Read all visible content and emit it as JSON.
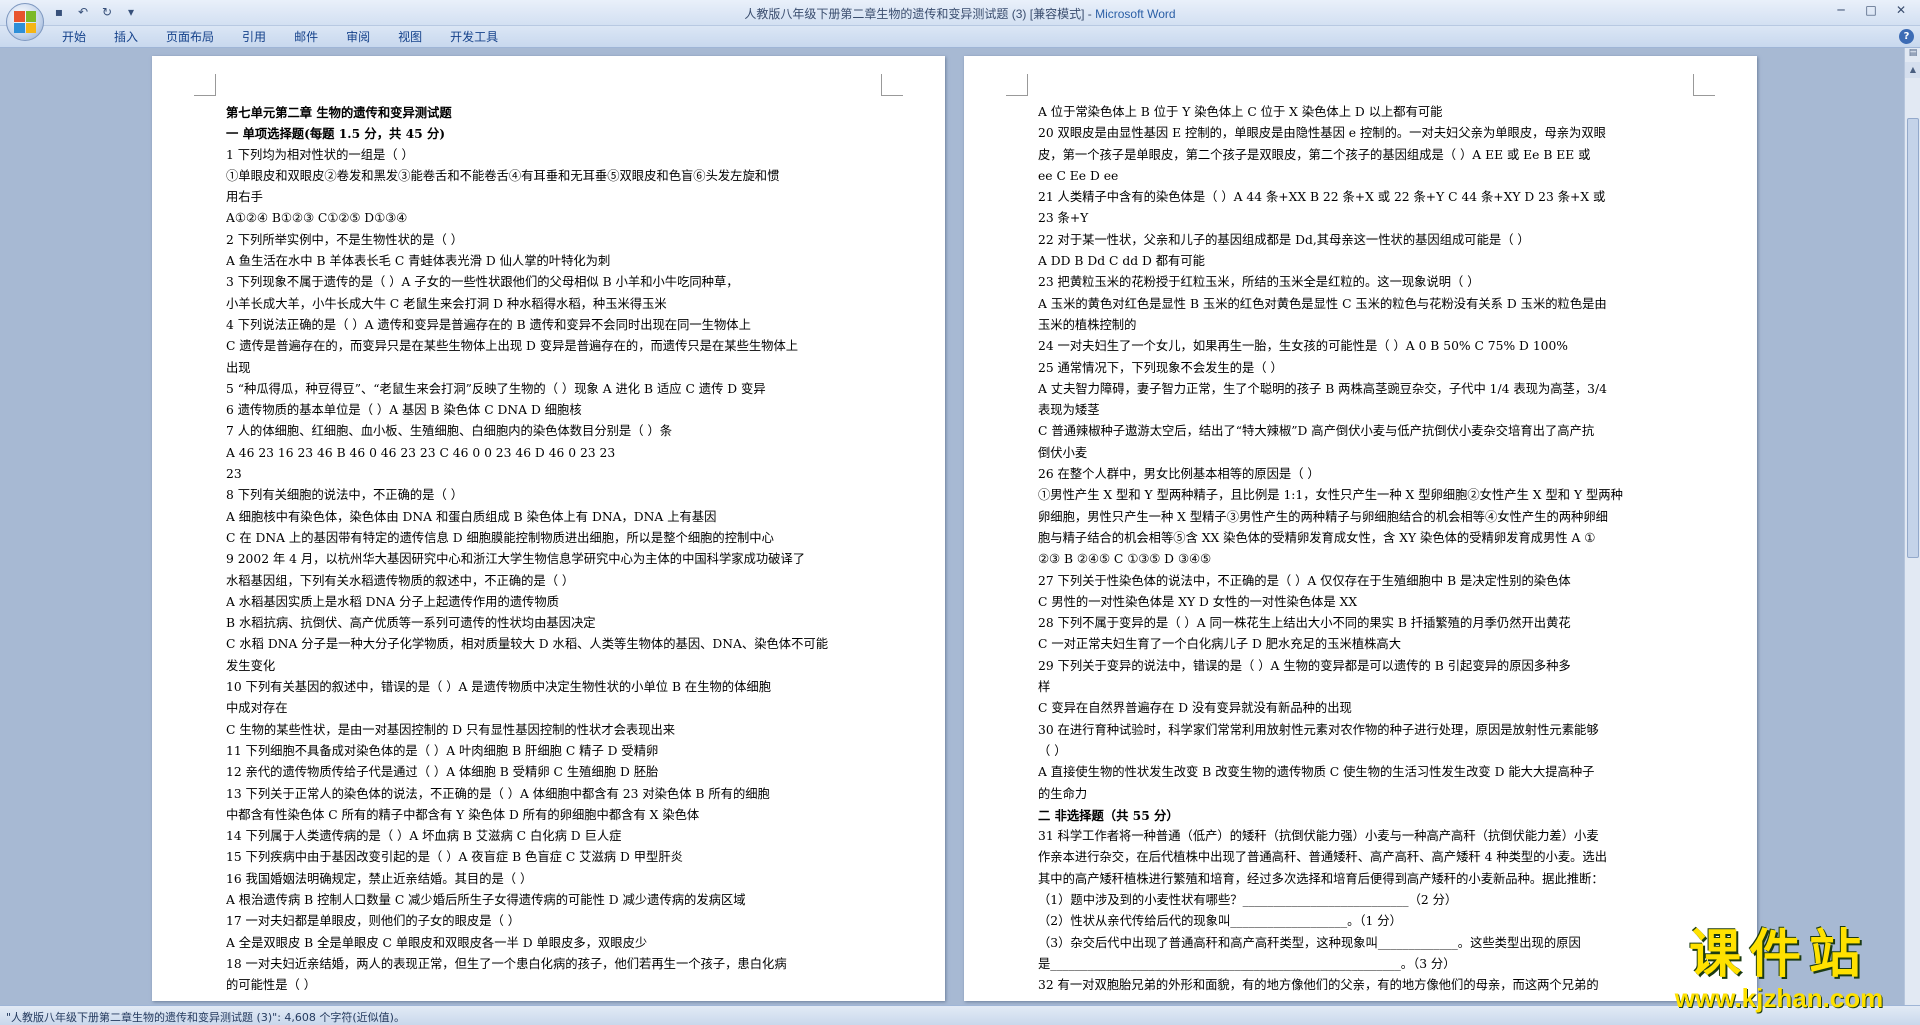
{
  "window": {
    "title": "人教版八年级下册第二章生物的遗传和变异测试题 (3) [兼容模式] - ",
    "app_name": "Microsoft Word"
  },
  "ribbon": {
    "tabs": [
      "开始",
      "插入",
      "页面布局",
      "引用",
      "邮件",
      "审阅",
      "视图",
      "开发工具"
    ]
  },
  "status": {
    "text": "\"人教版八年级下册第二章生物的遗传和变异测试题 (3)\": 4,608 个字符(近似值)。"
  },
  "watermark": {
    "title": "课件站",
    "url": "www.kjzhan.com"
  },
  "page1": {
    "lines": [
      "第七单元第二章 生物的遗传和变异测试题",
      "一 单项选择题(每题 1.5 分，共 45 分)",
      "1 下列均为相对性状的一组是（    ）",
      "①单眼皮和双眼皮②卷发和黑发③能卷舌和不能卷舌④有耳垂和无耳垂⑤双眼皮和色盲⑥头发左旋和惯",
      "用右手",
      "A①②④                    B①②③                    C①②⑤                    D①③④",
      "2 下列所举实例中，不是生物性状的是（    ）",
      "A 鱼生活在水中      B 羊体表长毛      C 青蛙体表光滑      D 仙人掌的叶特化为刺",
      "3 下列现象不属于遗传的是（    ）A 子女的一些性状跟他们的父母相似      B 小羊和小牛吃同种草，",
      "小羊长成大羊，小牛长成大牛 C 老鼠生来会打洞      D 种水稻得水稻，种玉米得玉米",
      "4 下列说法正确的是（    ）A 遗传和变异是普遍存在的      B 遗传和变异不会同时出现在同一生物体上",
      "C 遗传是普遍存在的，而变异只是在某些生物体上出现 D 变异是普遍存在的，而遗传只是在某些生物体上",
      "出现",
      "5 “种瓜得瓜，种豆得豆”、“老鼠生来会打洞”反映了生物的（  ）现象 A 进化 B 适应 C 遗传   D 变异",
      "6 遗传物质的基本单位是（    ）A 基因   B 染色体   C DNA    D 细胞核",
      "7 人的体细胞、红细胞、血小板、生殖细胞、白细胞内的染色体数目分别是（    ）条",
      "A   46   23   16   23   46    B   46   0   46   23   23   C   46   0   0   23   46        D   46   0   23   23",
      "23",
      "8 下列有关细胞的说法中，不正确的是（      ）",
      "A 细胞核中有染色体，染色体由 DNA 和蛋白质组成                B 染色体上有 DNA，DNA 上有基因",
      "C 在 DNA 上的基因带有特定的遗传信息      D 细胞膜能控制物质进出细胞，所以是整个细胞的控制中心",
      "9 2002 年 4 月，以杭州华大基因研究中心和浙江大学生物信息学研究中心为主体的中国科学家成功破译了",
      "水稻基因组，下列有关水稻遗传物质的叙述中，不正确的是（    ）",
      "A 水稻基因实质上是水稻 DNA 分子上起遗传作用的遗传物质",
      "B 水稻抗病、抗倒伏、高产优质等一系列可遗传的性状均由基因决定",
      "C 水稻 DNA 分子是一种大分子化学物质，相对质量较大 D 水稻、人类等生物体的基因、DNA、染色体不可能",
      "发生变化",
      "10 下列有关基因的叙述中，错误的是（    ）A 是遗传物质中决定生物性状的小单位   B 在生物的体细胞",
      "中成对存在",
      "C 生物的某些性状，是由一对基因控制的     D 只有显性基因控制的性状才会表现出来",
      "11 下列细胞不具备成对染色体的是（      ）A 叶肉细胞      B 肝细胞      C 精子    D 受精卵",
      "12 亲代的遗传物质传给子代是通过（      ）A 体细胞    B 受精卵   C 生殖细胞   D 胚胎",
      "13 下列关于正常人的染色体的说法，不正确的是（    ）A 体细胞中都含有 23 对染色体    B 所有的细胞",
      "中都含有性染色体 C 所有的精子中都含有 Y 染色体  D 所有的卵细胞中都含有 X 染色体",
      "14 下列属于人类遗传病的是（    ）A 坏血病      B 艾滋病      C 白化病     D 巨人症",
      "15 下列疾病中由于基因改变引起的是（    ）A 夜盲症        B 色盲症     C 艾滋病       D 甲型肝炎",
      "16 我国婚姻法明确规定，禁止近亲结婚。其目的是（    ）",
      "A 根治遗传病      B 控制人口数量 C 减少婚后所生子女得遗传病的可能性   D 减少遗传病的发病区域",
      "17 一对夫妇都是单眼皮，则他们的子女的眼皮是（    ）",
      "A 全是双眼皮      B 全是单眼皮        C 单眼皮和双眼皮各一半    D 单眼皮多，双眼皮少",
      "18 一对夫妇近亲结婚，两人的表现正常，但生了一个患白化病的孩子，他们若再生一个孩子，患白化病",
      "的可能性是（    ）"
    ]
  },
  "page2": {
    "lines": [
      "A   位于常染色体上            B 位于 Y 染色体上      C   位于 X 染色体上             D 以上都有可能",
      "20 双眼皮是由显性基因 E 控制的，单眼皮是由隐性基因 e 控制的。一对夫妇父亲为单眼皮，母亲为双眼",
      "皮，第一个孩子是单眼皮，第二个孩子是双眼皮，第二个孩子的基因组成是（  ）A EE 或 Ee    B EE 或",
      "ee     C   Ee D      ee",
      "21 人类精子中含有的染色体是（      ）A 44 条+XX   B  22 条+X 或 22 条+Y   C 44 条+XY    D  23 条+X 或",
      "23 条+Y",
      "22 对于某一性状，父亲和儿子的基因组成都是 Dd,其母亲这一性状的基因组成可能是（   ）",
      "A      DD    B       Dd    C       dd    D 都有可能",
      "23 把黄粒玉米的花粉授于红粒玉米，所结的玉米全是红粒的。这一现象说明（    ）",
      "A 玉米的黄色对红色是显性   B 玉米的红色对黄色是显性 C 玉米的粒色与花粉没有关系  D 玉米的粒色是由",
      "玉米的植株控制的",
      "24 一对夫妇生了一个女儿，如果再生一胎，生女孩的可能性是（      ）A  0   B   50%  C   75%    D   100%",
      "25 通常情况下，下列现象不会发生的是（    ）",
      "A 丈夫智力障碍，妻子智力正常，生了个聪明的孩子 B 两株高茎豌豆杂交，子代中 1/4 表现为高茎，3/4",
      "表现为矮茎",
      "C 普通辣椒种子遨游太空后，结出了“特大辣椒”D 高产倒伏小麦与低产抗倒伏小麦杂交培育出了高产抗",
      "倒伏小麦",
      "26 在整个人群中，男女比例基本相等的原因是（    ）",
      "①男性产生 X 型和 Y 型两种精子，且比例是 1:1，女性只产生一种 X 型卵细胞②女性产生 X 型和 Y 型两种",
      "卵细胞，男性只产生一种 X 型精子③男性产生的两种精子与卵细胞结合的机会相等④女性产生的两种卵细",
      "胞与精子结合的机会相等⑤含 XX 染色体的受精卵发育成女性，含 XY 染色体的受精卵发育成男性 A    ①",
      "②③   B   ②④⑤   C   ①③⑤   D    ③④⑤",
      "27 下列关于性染色体的说法中，不正确的是（    ）A 仅仅存在于生殖细胞中        B 是决定性别的染色体",
      "C 男性的一对性染色体是 XY    D 女性的一对性染色体是 XX",
      "28 下列不属于变异的是（      ）A 同一株花生上结出大小不同的果实   B 扦插繁殖的月季仍然开出黄花",
      "C 一对正常夫妇生育了一个白化病儿子 D 肥水充足的玉米植株高大",
      "29 下列关于变异的说法中，错误的是（      ）A 生物的变异都是可以遗传的       B 引起变异的原因多种多",
      "样",
      "C 变异在自然界普遍存在          D 没有变异就没有新品种的出现",
      "30 在进行育种试验时，科学家们常常利用放射性元素对农作物的种子进行处理，原因是放射性元素能够",
      "（    ）",
      "A 直接使生物的性状发生改变     B 改变生物的遗传物质 C 使生物的生活习性发生改变     D 能大大提高种子",
      "的生命力",
      "二 非选择题（共 55 分）",
      "31 科学工作者将一种普通（低产）的矮秆（抗倒伏能力强）小麦与一种高产高秆（抗倒伏能力差）小麦",
      "作亲本进行杂交，在后代植株中出现了普通高秆、普通矮秆、高产高秆、高产矮秆 4 种类型的小麦。选出",
      "其中的高产矮秆植株进行繁殖和培育，经过多次选择和培育后便得到高产矮秆的小麦新品种。据此推断：",
      "（1）题中涉及到的小麦性状有哪些？___________________________（2 分）",
      "（2）性状从亲代传给后代的现象叫___________________。（1 分）",
      "（3）杂交后代中出现了普通高秆和高产高秆类型，这种现象叫_____________。这些类型出现的原因",
      "是_________________________________________________________。（3 分）",
      "32 有一对双胞胎兄弟的外形和面貌，有的地方像他们的父亲，有的地方像他们的母亲，而这两个兄弟的"
    ]
  }
}
